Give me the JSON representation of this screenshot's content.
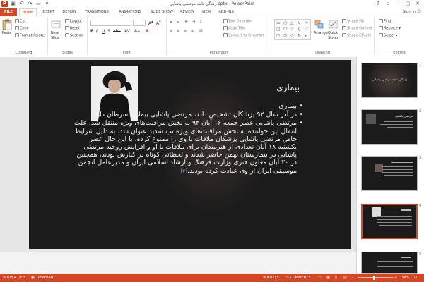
{
  "window": {
    "title": "زندگی نامه مرتضی پاشایی.pptx - PowerPoint",
    "signin": "Sign in",
    "help": "?"
  },
  "tabs": [
    "FILE",
    "HOME",
    "INSERT",
    "DESIGN",
    "TRANSITIONS",
    "ANIMATIONS",
    "SLIDE SHOW",
    "REVIEW",
    "VIEW",
    "ADD-INS"
  ],
  "ribbon": {
    "clipboard": {
      "paste": "Paste",
      "cut": "Cut",
      "copy": "Copy",
      "format_painter": "Format Painter",
      "label": "Clipboard"
    },
    "slides": {
      "new_slide": "New Slide",
      "layout": "Layout",
      "reset": "Reset",
      "section": "Section",
      "label": "Slides"
    },
    "font": {
      "label": "Font"
    },
    "paragraph": {
      "text_direction": "Text Direction",
      "align_text": "Align Text",
      "convert": "Convert to SmartArt",
      "label": "Paragraph"
    },
    "drawing": {
      "arrange": "Arrange",
      "quick_styles": "Quick Styles",
      "shape_fill": "Shape Fill",
      "shape_outline": "Shape Outline",
      "shape_effects": "Shape Effects",
      "label": "Drawing"
    },
    "editing": {
      "find": "Find",
      "replace": "Replace",
      "select": "Select",
      "label": "Editing"
    }
  },
  "slide": {
    "title": "بیماری",
    "bullets": [
      "بیماری",
      "در آذر سال ۹۲ پزشکان تشخیص دادند مرتضی پاشایی بیماری سرطان دارد.",
      "مرتضی پاشایی عصر جمعه ۱۶ آبان ۹۳ به بخش مراقبت‌های ویژه منتقل شد. علت انتقال این خواننده به بخش مراقبت‌های ویژه تب شدید عنوان شد. به دلیل شرایط خاص مرتضی پاشایی پزشکان ملاقات با وی را ممنوع کرده، با این حال عصر یکشنبه ۱۸ آبان تعدادی از هنرمندان برای ملاقات با او و افزایش روحیه مرتضی پاشایی در بیمارستان بهمن حاضر شدند و لحظاتی کوتاه در کنارش بودند، همچنین در ۲۰ آبان معاون هنری وزارت فرهنگ و ارشاد اسلامی ایران و مدیرعامل انجمن موسیقی ایران از وی عیادت کرده بودند."
    ],
    "ref": "[۲]"
  },
  "thumbnails": [
    {
      "num": "1",
      "title": "زندگی نامه مرتضی پاشایی"
    },
    {
      "num": "2",
      "title": "مرتضی پاشایی"
    },
    {
      "num": "3",
      "title": ""
    },
    {
      "num": "4",
      "title": ""
    },
    {
      "num": "5",
      "title": ""
    }
  ],
  "status": {
    "slide": "SLIDE 4 OF 8",
    "language": "PERSIAN",
    "notes": "NOTES",
    "comments": "COMMENTS",
    "zoom": "34%"
  },
  "colors": {
    "accent": "#d24726",
    "slide_bg": "#1c1b1b",
    "selected_thumb": "#d04a23"
  }
}
